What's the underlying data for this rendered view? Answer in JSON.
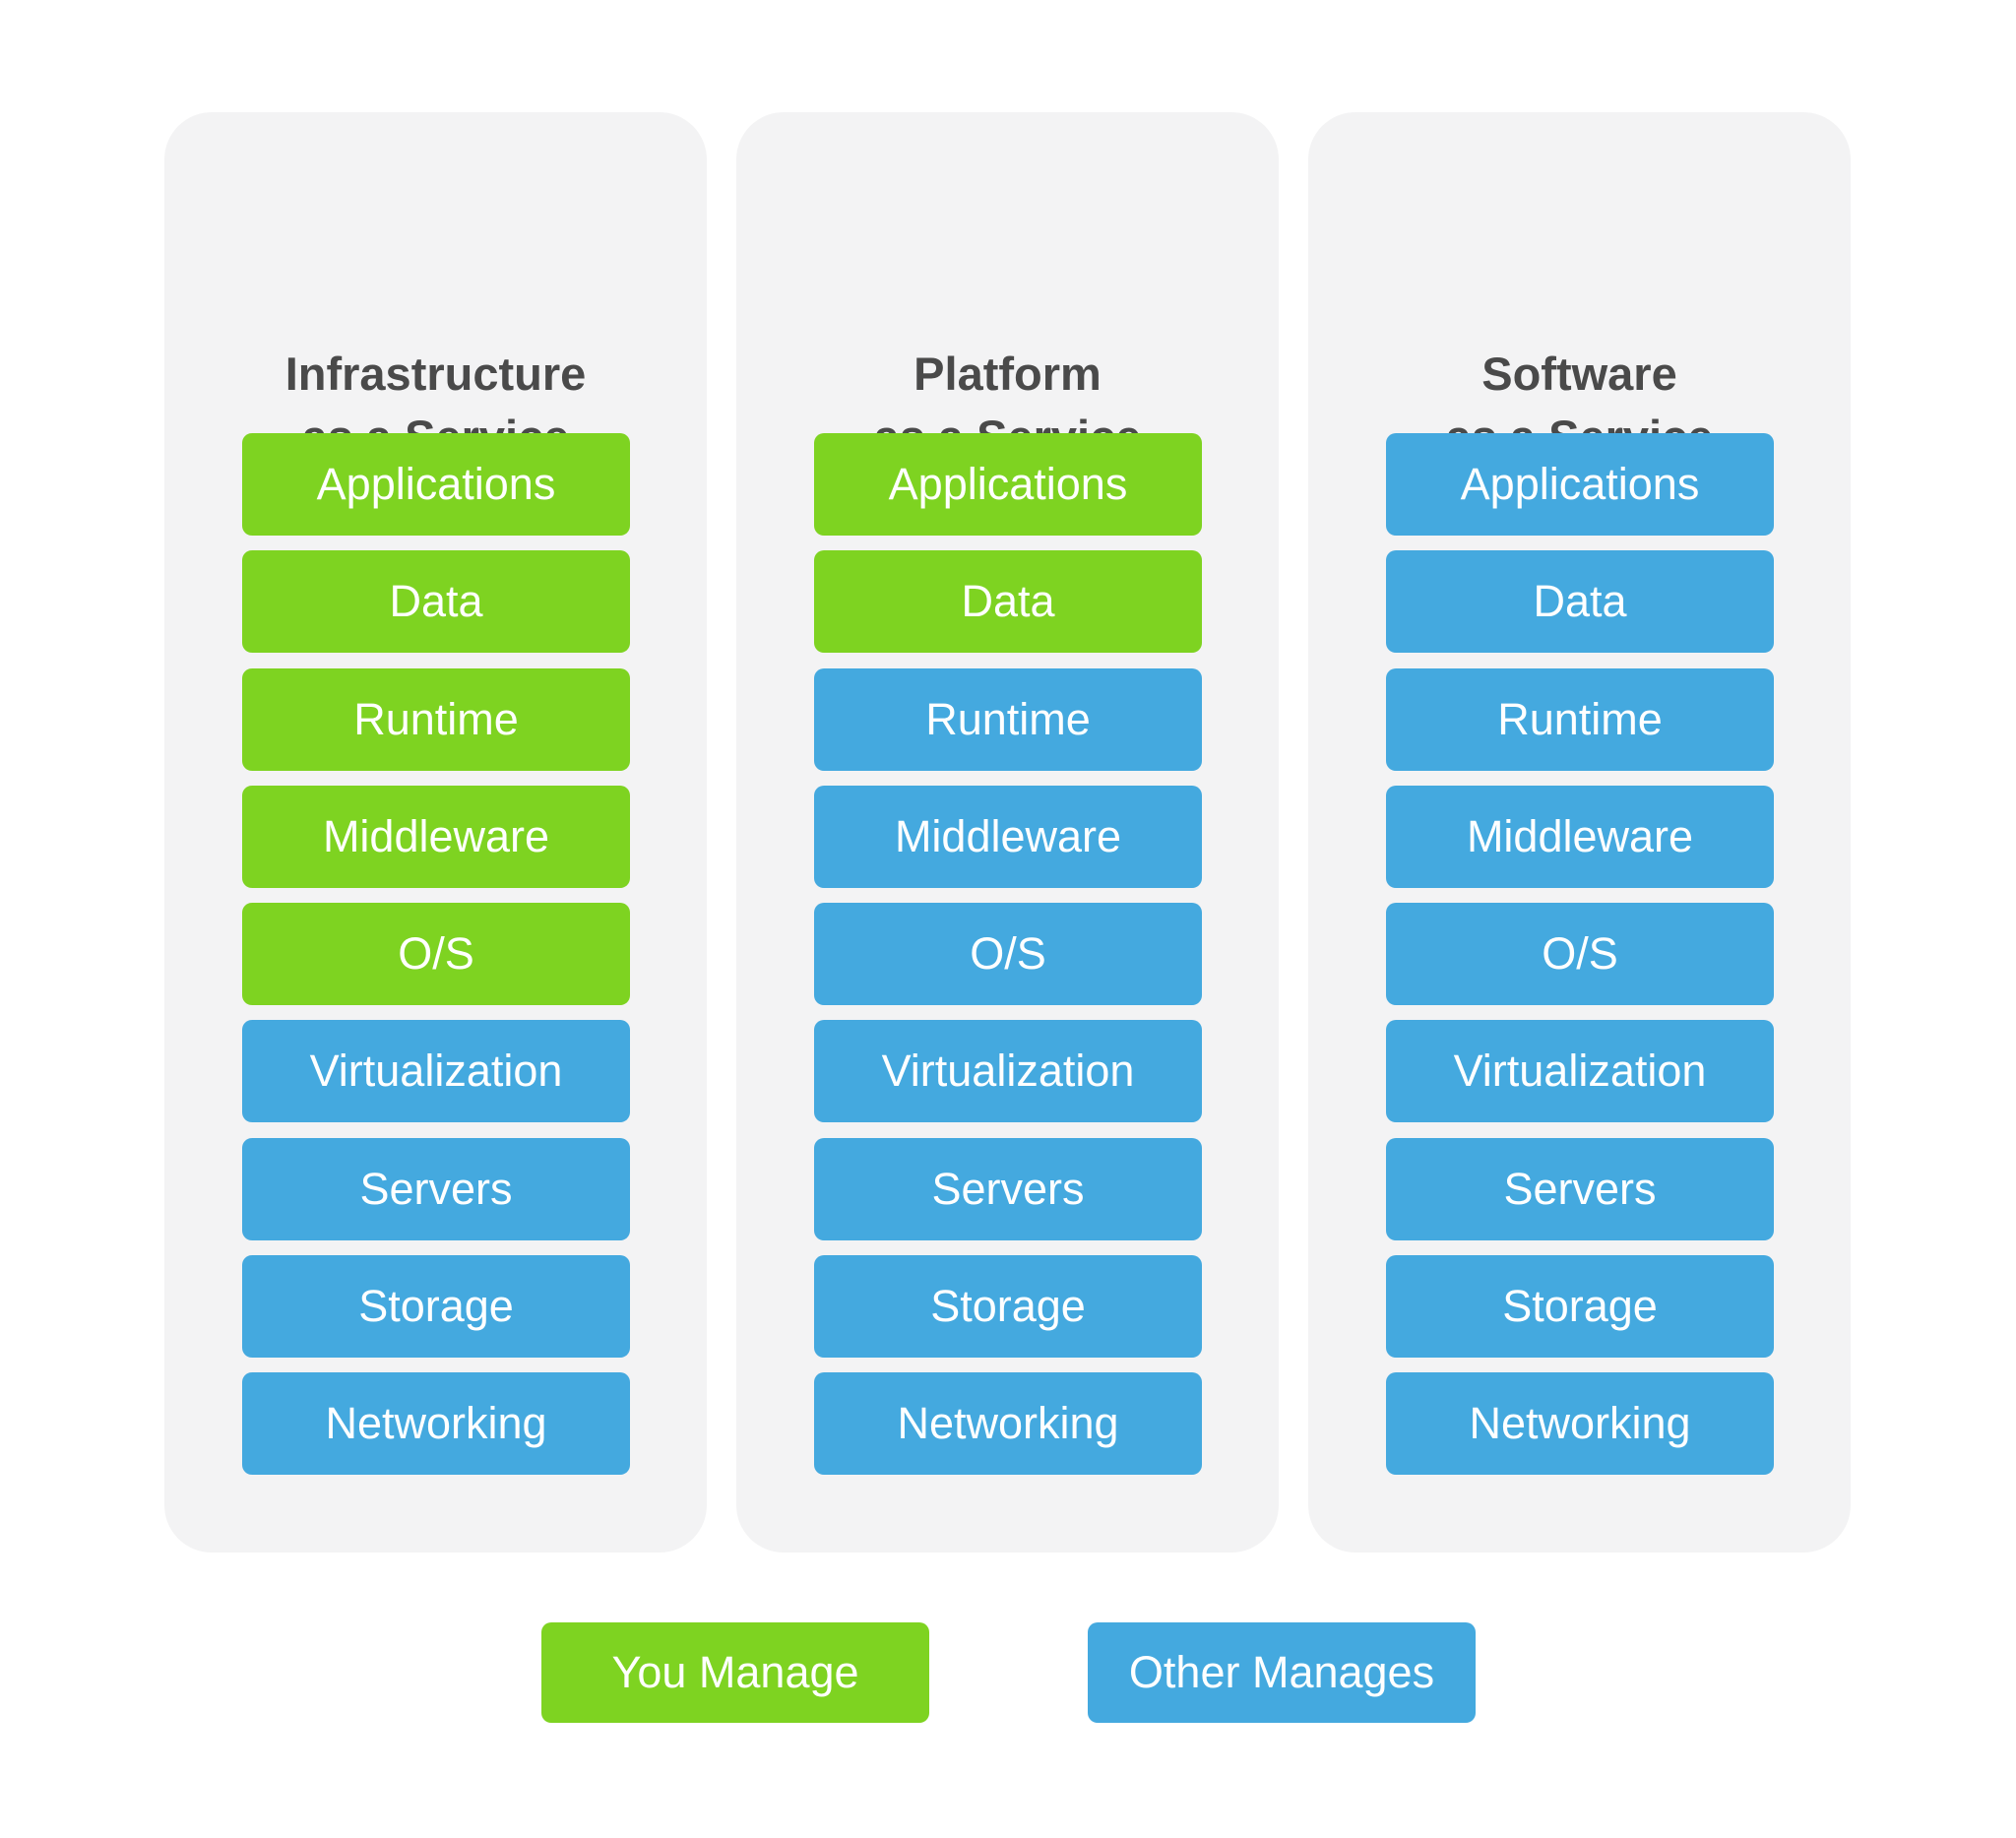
{
  "colors": {
    "you_manage": "#7ed321",
    "other_manages": "#44a9df",
    "panel_bg": "#f3f3f4",
    "title_text": "#4a4a4a"
  },
  "columns": [
    {
      "title_line1": "Infrastructure",
      "title_line2": "as a Service",
      "layers": [
        {
          "label": "Applications",
          "managed_by": "you"
        },
        {
          "label": "Data",
          "managed_by": "you"
        },
        {
          "label": "Runtime",
          "managed_by": "you"
        },
        {
          "label": "Middleware",
          "managed_by": "you"
        },
        {
          "label": "O/S",
          "managed_by": "you"
        },
        {
          "label": "Virtualization",
          "managed_by": "other"
        },
        {
          "label": "Servers",
          "managed_by": "other"
        },
        {
          "label": "Storage",
          "managed_by": "other"
        },
        {
          "label": "Networking",
          "managed_by": "other"
        }
      ]
    },
    {
      "title_line1": "Platform",
      "title_line2": "as a Service",
      "layers": [
        {
          "label": "Applications",
          "managed_by": "you"
        },
        {
          "label": "Data",
          "managed_by": "you"
        },
        {
          "label": "Runtime",
          "managed_by": "other"
        },
        {
          "label": "Middleware",
          "managed_by": "other"
        },
        {
          "label": "O/S",
          "managed_by": "other"
        },
        {
          "label": "Virtualization",
          "managed_by": "other"
        },
        {
          "label": "Servers",
          "managed_by": "other"
        },
        {
          "label": "Storage",
          "managed_by": "other"
        },
        {
          "label": "Networking",
          "managed_by": "other"
        }
      ]
    },
    {
      "title_line1": "Software",
      "title_line2": "as a Service",
      "layers": [
        {
          "label": "Applications",
          "managed_by": "other"
        },
        {
          "label": "Data",
          "managed_by": "other"
        },
        {
          "label": "Runtime",
          "managed_by": "other"
        },
        {
          "label": "Middleware",
          "managed_by": "other"
        },
        {
          "label": "O/S",
          "managed_by": "other"
        },
        {
          "label": "Virtualization",
          "managed_by": "other"
        },
        {
          "label": "Servers",
          "managed_by": "other"
        },
        {
          "label": "Storage",
          "managed_by": "other"
        },
        {
          "label": "Networking",
          "managed_by": "other"
        }
      ]
    }
  ],
  "legend": {
    "you_manage": "You Manage",
    "other_manages": "Other Manages"
  }
}
